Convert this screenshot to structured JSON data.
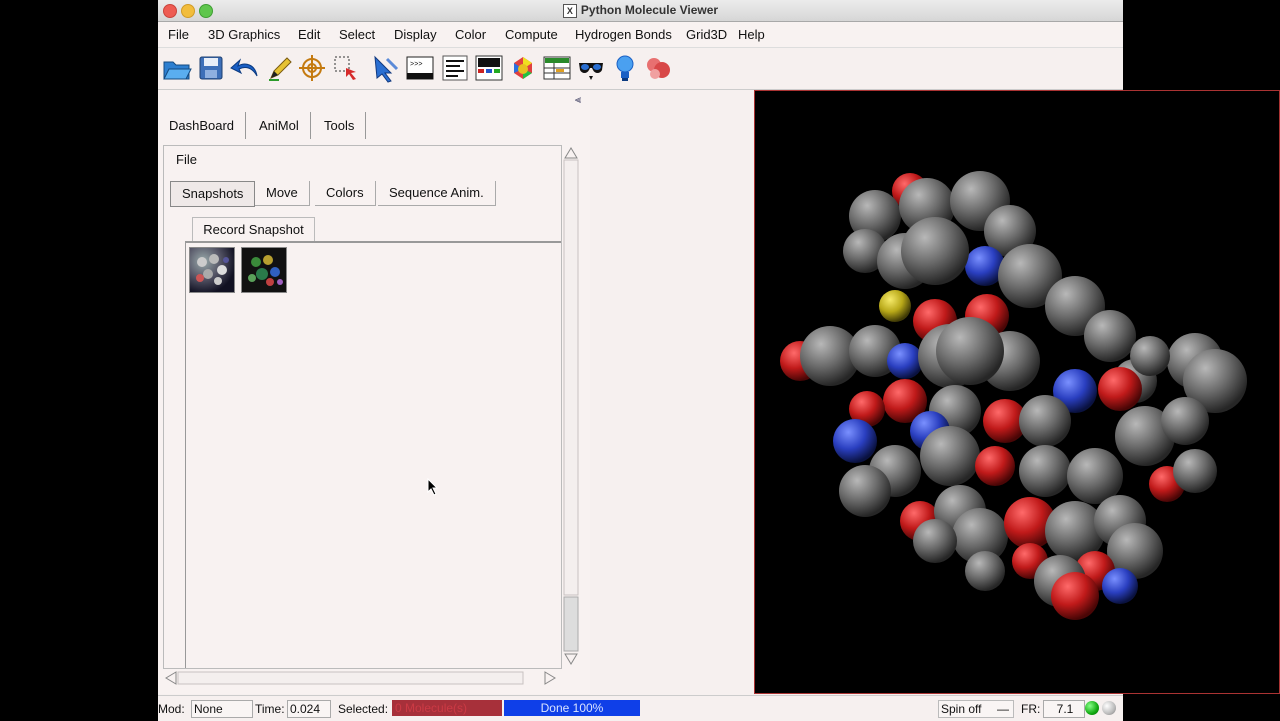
{
  "window": {
    "title": "Python Molecule Viewer"
  },
  "menu": [
    "File",
    "3D Graphics",
    "Edit",
    "Select",
    "Display",
    "Color",
    "Compute",
    "Hydrogen Bonds",
    "Grid3D",
    "Help"
  ],
  "toolbar_icons": [
    "open-icon",
    "save-icon",
    "undo-icon",
    "pencil-icon",
    "target-icon",
    "select-box-icon",
    "pointer-icon",
    "python-shell-icon",
    "text-lines-icon",
    "display-panel-icon",
    "color-palette-icon",
    "table-icon",
    "stereo-glasses-icon",
    "light-bulb-icon",
    "bubbles-icon"
  ],
  "panel": {
    "main_tabs": [
      "DashBoard",
      "AniMol",
      "Tools"
    ],
    "file_menu": "File",
    "sub_tabs": [
      "Snapshots",
      "Move",
      "Colors",
      "Sequence Anim."
    ],
    "record_button": "Record Snapshot",
    "snapshot_count": 2
  },
  "status": {
    "mod_label": "Mod:",
    "mod_value": "None",
    "time_label": "Time:",
    "time_value": "0.024",
    "selected_label": "Selected:",
    "selected_value": "0 Molecule(s)",
    "progress_text": "Done 100%",
    "spin_value": "Spin off",
    "fr_label": "FR:",
    "fr_value": "7.1"
  },
  "colors": {
    "selected_bg": "#a7303a",
    "progress_bg": "#0f3fe8",
    "viewer_bg": "#000000"
  }
}
